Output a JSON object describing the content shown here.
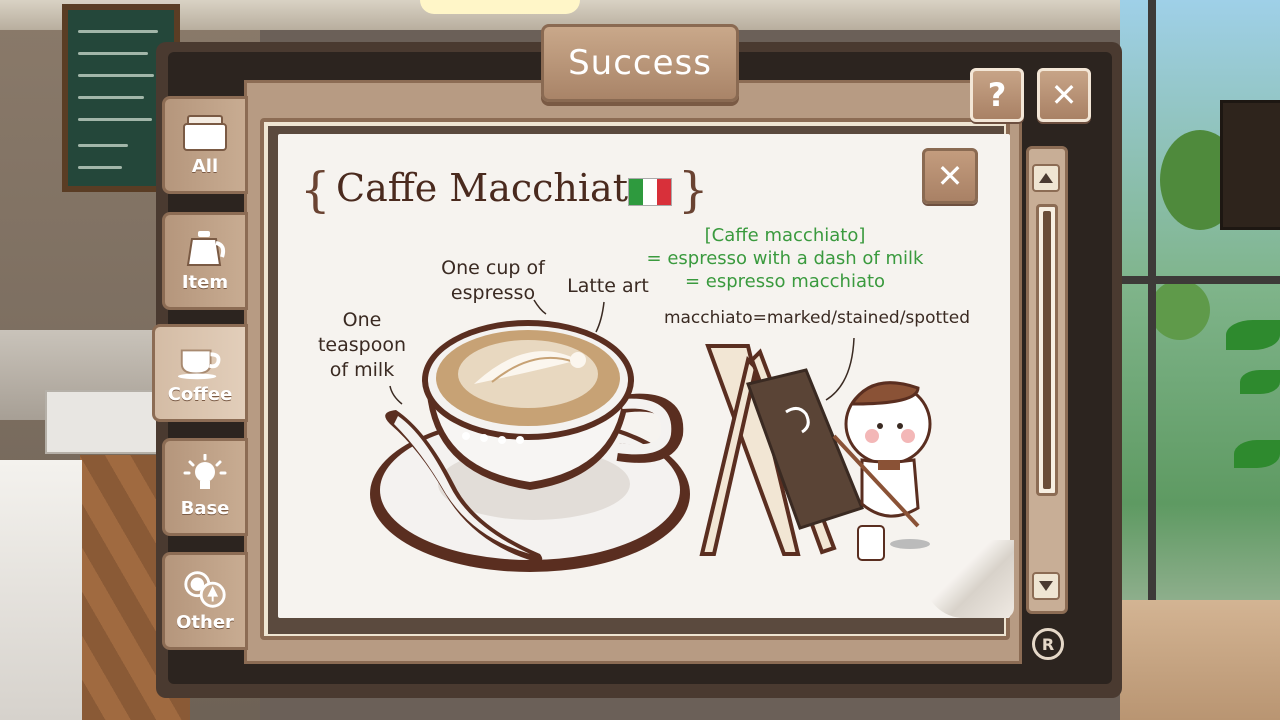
{
  "dialog": {
    "title": "Success",
    "help_button": "?",
    "close_button": "✕"
  },
  "tabs": [
    {
      "label": "All",
      "icon": "folder-icon",
      "active": false
    },
    {
      "label": "Item",
      "icon": "kettle-icon",
      "active": false
    },
    {
      "label": "Coffee",
      "icon": "coffee-cup-icon",
      "active": true
    },
    {
      "label": "Base",
      "icon": "lightbulb-icon",
      "active": false
    },
    {
      "label": "Other",
      "icon": "ingredients-icon",
      "active": false
    }
  ],
  "card": {
    "title": "Caffe Macchiato",
    "flag": "italy-flag",
    "close_button": "✕",
    "labels": {
      "espresso_line1": "One cup of",
      "espresso_line2": "espresso",
      "latte_art": "Latte art",
      "milk_line1": "One",
      "milk_line2": "teaspoon",
      "milk_line3": "of milk",
      "definition_line1": "[Caffe macchiato]",
      "definition_line2": "= espresso with a dash of milk",
      "definition_line3": "= espresso macchiato",
      "meaning": "macchiato=marked/stained/spotted"
    }
  },
  "footer": {
    "badge": "R"
  },
  "colors": {
    "frame_brown": "#8c6c54",
    "panel_tan": "#b79b83",
    "card_bg": "#f6f3ef",
    "title_text": "#4a2a1e",
    "green_note": "#3a9a3e"
  }
}
